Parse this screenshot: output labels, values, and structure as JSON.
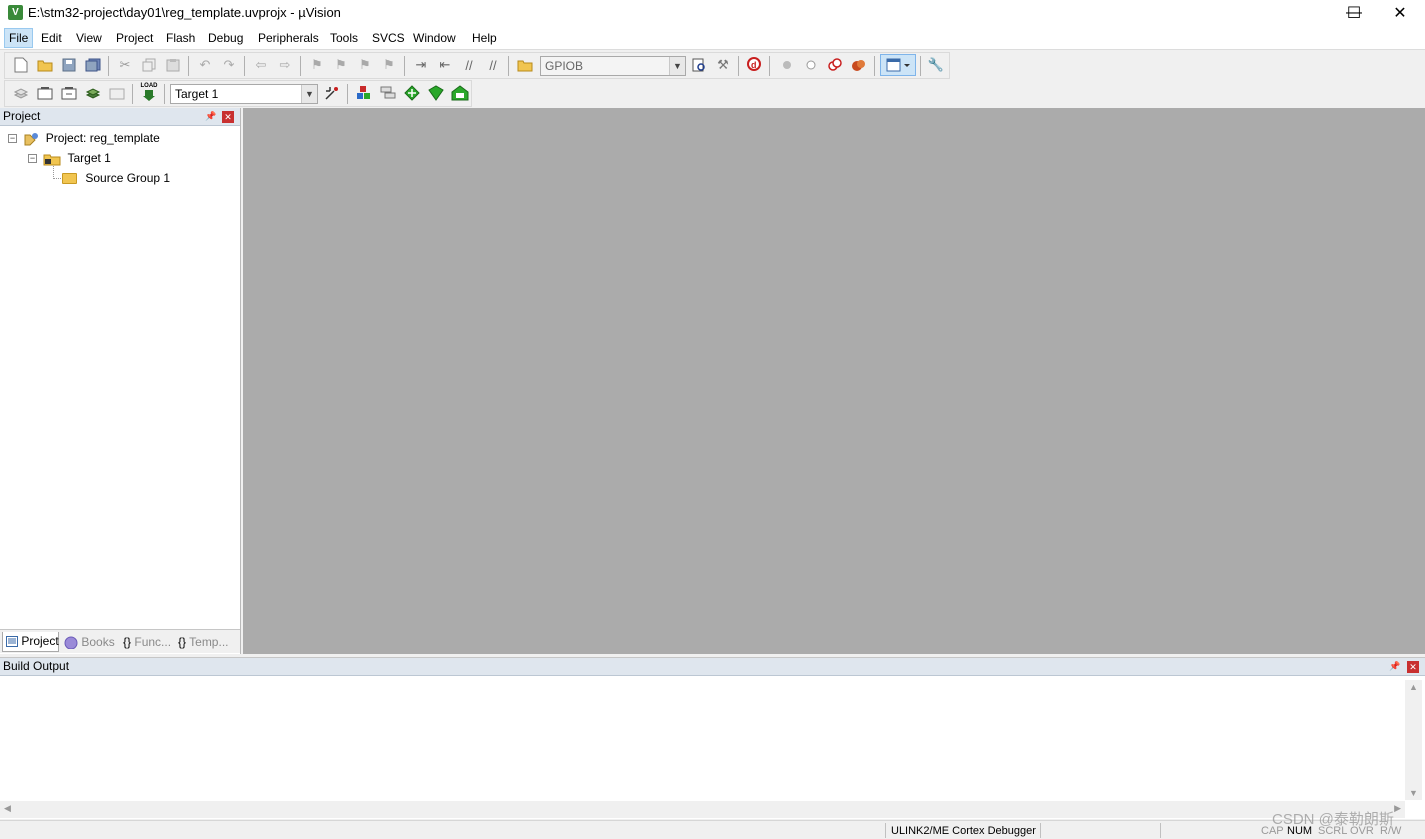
{
  "window": {
    "title": "E:\\stm32-project\\day01\\reg_template.uvprojx - µVision",
    "app_icon": "V",
    "controls": {
      "minimize": "—",
      "maximize": "☐",
      "close": "✕"
    }
  },
  "menu": [
    {
      "label": "File"
    },
    {
      "label": "Edit"
    },
    {
      "label": "View"
    },
    {
      "label": "Project"
    },
    {
      "label": "Flash"
    },
    {
      "label": "Debug"
    },
    {
      "label": "Peripherals"
    },
    {
      "label": "Tools"
    },
    {
      "label": "SVCS"
    },
    {
      "label": "Window"
    },
    {
      "label": "Help"
    }
  ],
  "toolbar1": {
    "find_combo_value": "GPIOB",
    "icons": [
      "new-file-icon",
      "open-file-icon",
      "save-icon",
      "save-all-icon",
      "cut-icon",
      "copy-icon",
      "paste-icon",
      "undo-icon",
      "redo-icon",
      "nav-back-icon",
      "nav-forward-icon",
      "bookmark-icon",
      "prev-bookmark-icon",
      "next-bookmark-icon",
      "clear-bookmarks-icon",
      "indent-icon",
      "unindent-icon",
      "comment-icon",
      "uncomment-icon",
      "find-in-files-icon",
      "find-icon",
      "incremental-find-icon",
      "debug-session-icon",
      "breakpoint-icon",
      "disable-breakpoint-icon",
      "disable-all-breakpoints-icon",
      "kill-breakpoints-icon",
      "window-layout-icon",
      "configure-icon"
    ]
  },
  "toolbar2": {
    "load_label": "LOAD",
    "target_combo_value": "Target 1",
    "icons": [
      "translate-icon",
      "build-icon",
      "rebuild-icon",
      "batch-build-icon",
      "stop-build-icon",
      "download-icon",
      "target-options-icon",
      "manage-components-icon",
      "file-extensions-icon",
      "pack-installer-icon",
      "run-time-env-icon",
      "select-packs-icon"
    ]
  },
  "project_panel": {
    "title": "Project",
    "tree": [
      {
        "label": "Project: reg_template",
        "level": 0
      },
      {
        "label": "Target 1",
        "level": 1
      },
      {
        "label": "Source Group 1",
        "level": 2
      }
    ],
    "tabs": [
      {
        "label": "Project"
      },
      {
        "label": "Books"
      },
      {
        "label": "Func..."
      },
      {
        "label": "Temp..."
      }
    ]
  },
  "build_output": {
    "title": "Build Output",
    "content": ""
  },
  "statusbar": {
    "debugger": "ULINK2/ME Cortex Debugger",
    "indicators": [
      "CAP",
      "NUM",
      "SCRL",
      "OVR",
      "R/W"
    ]
  },
  "watermark": "CSDN @泰勒朗斯",
  "colors": {
    "editor_bg": "#ababab",
    "panel_header": "#dfe6ee",
    "close_red": "#c83030"
  }
}
